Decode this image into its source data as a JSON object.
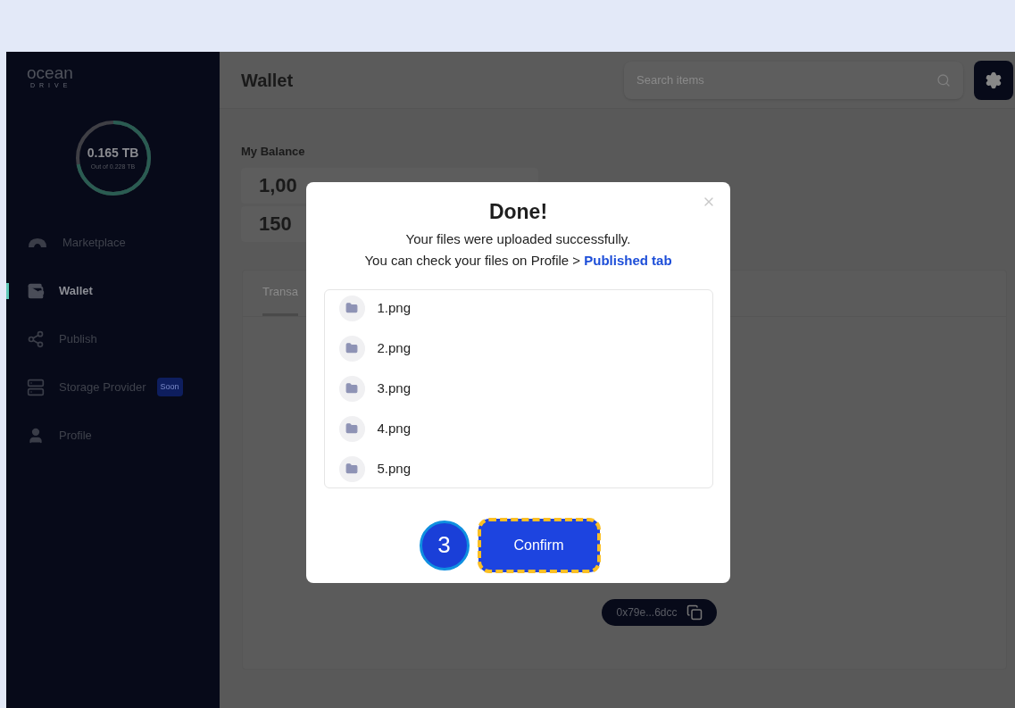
{
  "sidebar": {
    "logo": {
      "name": "ocean",
      "tagline": "DRIVE"
    },
    "storage": {
      "used": "0.165 TB",
      "total": "Out of 0.228 TB",
      "level": 0.72
    },
    "items": [
      {
        "kind": "marketplace",
        "label": "Marketplace",
        "selected": false
      },
      {
        "kind": "wallet",
        "label": "Wallet",
        "selected": true
      },
      {
        "kind": "publish",
        "label": "Publish",
        "selected": false
      },
      {
        "kind": "storage",
        "label": "Storage Provider",
        "badge": "Soon",
        "selected": false
      },
      {
        "kind": "profile",
        "label": "Profile",
        "selected": false
      }
    ]
  },
  "header": {
    "title": "Wallet",
    "search": {
      "placeholder": "Search items"
    }
  },
  "balance": {
    "title": "My Balance",
    "rows": [
      "1,00",
      "150"
    ]
  },
  "tabs": [
    {
      "label": "Transa",
      "selected": true
    }
  ],
  "address": "0x79e...6dcc",
  "dialog": {
    "title": "Done!",
    "message": "Your files were uploaded successfully.",
    "hint": "You can check your files on Profile > ",
    "link": "Published tab",
    "files": [
      "1.png",
      "2.png",
      "3.png",
      "4.png",
      "5.png"
    ],
    "step": "3",
    "confirm": "Confirm"
  }
}
